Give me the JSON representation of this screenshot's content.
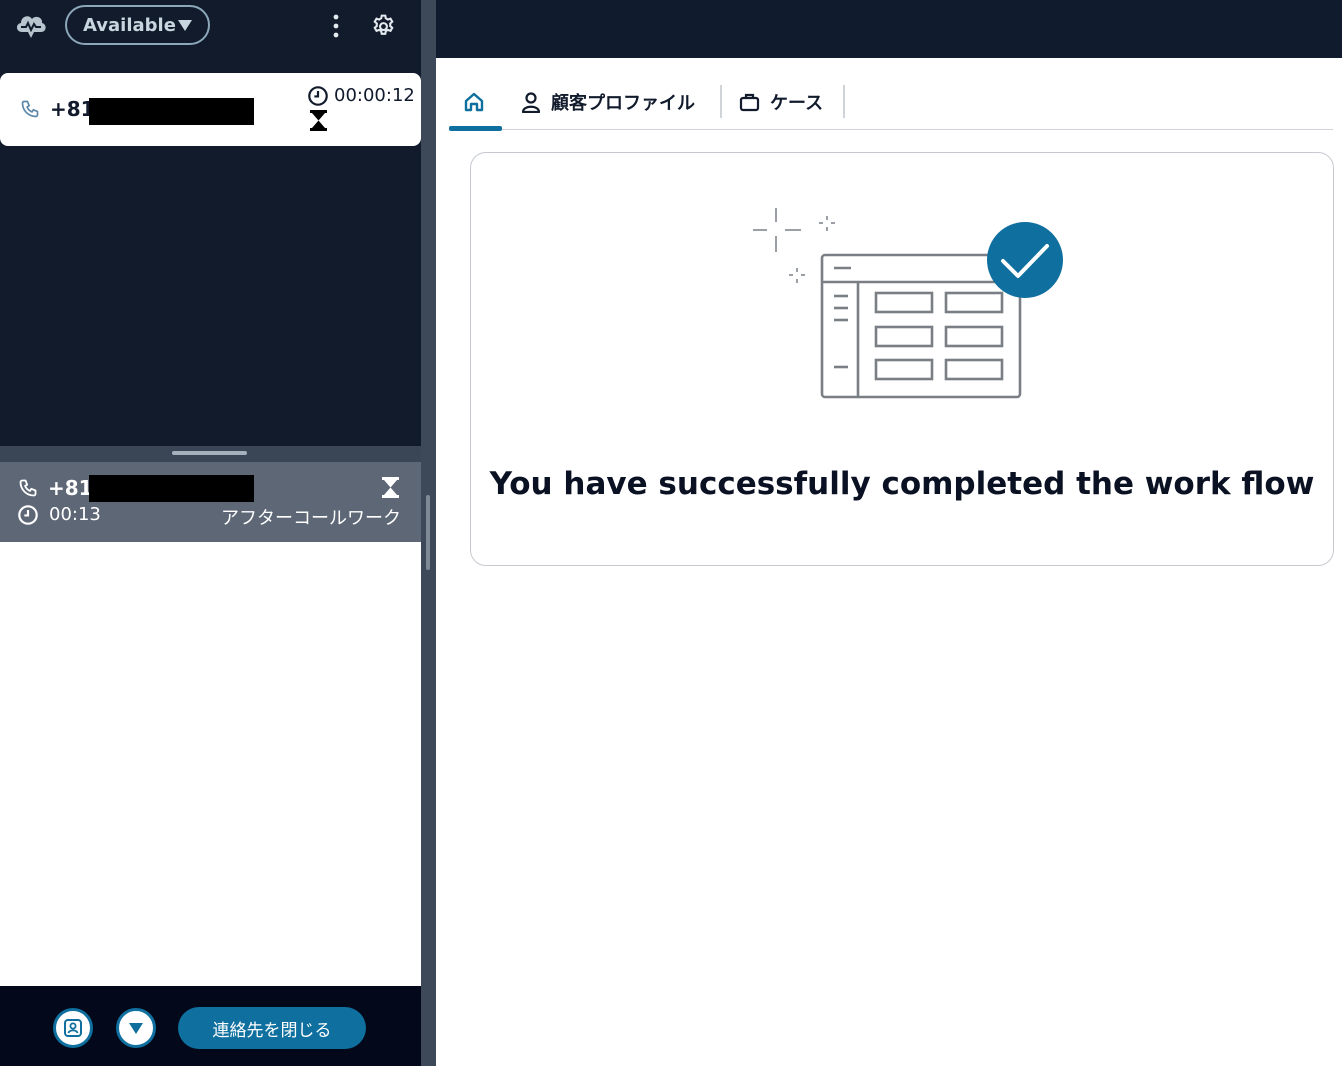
{
  "ccp": {
    "status": {
      "label": "Available"
    },
    "active_contact": {
      "number_prefix": "+81",
      "timer": "00:00:12"
    },
    "acw_contact": {
      "number_prefix": "+81",
      "timer": "00:13",
      "state": "アフターコールワーク"
    },
    "footer": {
      "close_contact_label": "連絡先を閉じる"
    }
  },
  "workspace": {
    "tabs": [
      {
        "label": "",
        "icon": "home-icon",
        "active": true
      },
      {
        "label": "顧客プロファイル",
        "icon": "person-icon",
        "active": false
      },
      {
        "label": "ケース",
        "icon": "briefcase-icon",
        "active": false
      }
    ],
    "completion_message": "You have successfully completed the work flow"
  },
  "colors": {
    "ccp_background": "#111b2c",
    "accent": "#0f6f9e",
    "acw_row": "#5d6776"
  }
}
